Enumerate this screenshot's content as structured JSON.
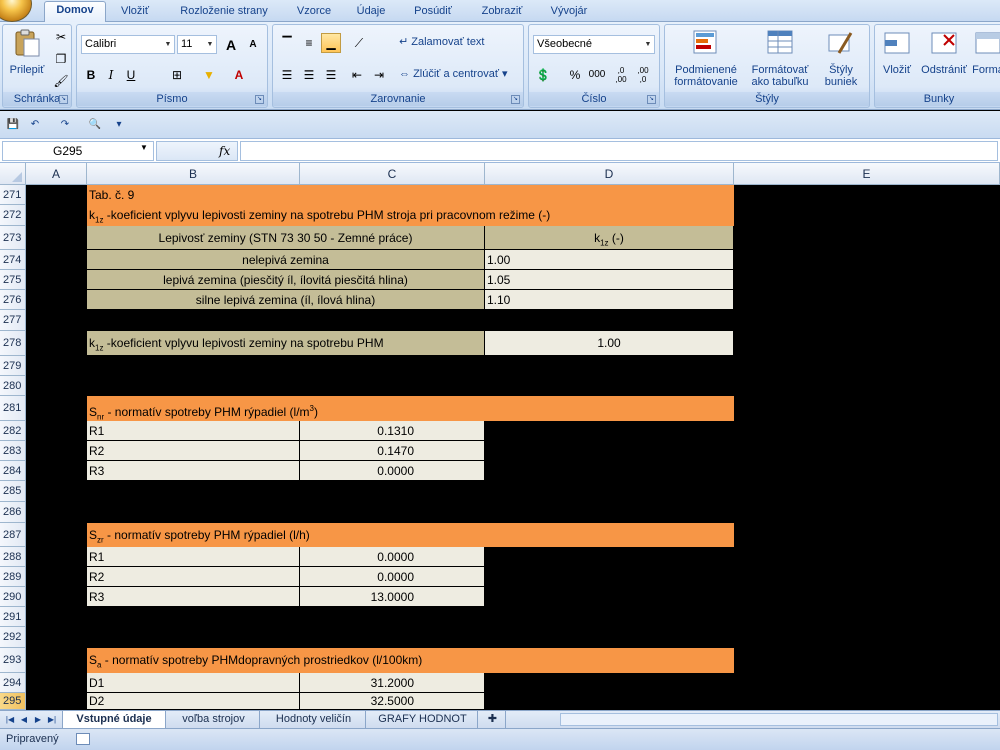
{
  "ribbon": {
    "tabs": [
      "Domov",
      "Vložiť",
      "Rozloženie strany",
      "Vzorce",
      "Údaje",
      "Posúdiť",
      "Zobraziť",
      "Vývojár"
    ],
    "clipboard": {
      "paste_label": "Prilepiť",
      "group_label": "Schránka"
    },
    "font": {
      "name": "Calibri",
      "size": "11",
      "bold": "B",
      "italic": "I",
      "underline": "U",
      "grow": "A",
      "shrink": "A",
      "group_label": "Písmo"
    },
    "alignment": {
      "wrap_label": "Zalamovať text",
      "merge_label": "Zlúčiť a centrovať",
      "group_label": "Zarovnanie"
    },
    "number": {
      "format": "Všeobecné",
      "percent": "%",
      "thousands": "000",
      "inc_dec": ",0 ,00",
      "dec_dec": ",00 ,0",
      "group_label": "Číslo"
    },
    "styles": {
      "cond_format": "Podmienené formátovanie",
      "format_table": "Formátovať ako tabuľku",
      "cell_styles": "Štýly buniek",
      "group_label": "Štýly"
    },
    "cells": {
      "insert": "Vložiť",
      "delete": "Odstrániť",
      "format": "Formá",
      "group_label": "Bunky"
    }
  },
  "formula_bar": {
    "name_box": "G295",
    "fx": "fx",
    "formula": ""
  },
  "columns": [
    "A",
    "B",
    "C",
    "D",
    "E"
  ],
  "rows": {
    "r271": {
      "num": "271",
      "b": "Tab. č. 9"
    },
    "r272": {
      "num": "272",
      "b_sym": "k",
      "b_sub": "1z",
      "b_rest": " -koeficient vplyvu lepivosti zeminy na spotrebu PHM stroja pri pracovnom režime (-)"
    },
    "r273": {
      "num": "273",
      "b": "Lepivosť zeminy (STN 73 30 50 - Zemné práce)",
      "d_sym": "k",
      "d_sub": "1z",
      "d_rest": " (-)"
    },
    "r274": {
      "num": "274",
      "b": "nelepivá zemina",
      "d": "1.00"
    },
    "r275": {
      "num": "275",
      "b": "lepivá zemina (piesčitý íl, ílovitá piesčitá hlina)",
      "d": "1.05"
    },
    "r276": {
      "num": "276",
      "b": "silne lepivá zemina (íl, ílová hlina)",
      "d": "1.10"
    },
    "r277": {
      "num": "277"
    },
    "r278": {
      "num": "278",
      "b_sym": "k",
      "b_sub": "1z",
      "b_rest": " -koeficient vplyvu lepivosti zeminy na spotrebu PHM",
      "d": "1.00"
    },
    "r279": {
      "num": "279"
    },
    "r280": {
      "num": "280"
    },
    "r281": {
      "num": "281",
      "b_sym": "S",
      "b_sub": "nr",
      "b_rest": " - normatív spotreby PHM rýpadiel (l/m",
      "b_sup": "3",
      "b_end": ")"
    },
    "r282": {
      "num": "282",
      "b": "R1",
      "c": "0.1310"
    },
    "r283": {
      "num": "283",
      "b": "R2",
      "c": "0.1470"
    },
    "r284": {
      "num": "284",
      "b": "R3",
      "c": "0.0000"
    },
    "r285": {
      "num": "285"
    },
    "r286": {
      "num": "286"
    },
    "r287": {
      "num": "287",
      "b_sym": "S",
      "b_sub": "zr",
      "b_rest": " - normatív spotreby PHM rýpadiel (l/h)"
    },
    "r288": {
      "num": "288",
      "b": "R1",
      "c": "0.0000"
    },
    "r289": {
      "num": "289",
      "b": "R2",
      "c": "0.0000"
    },
    "r290": {
      "num": "290",
      "b": "R3",
      "c": "13.0000"
    },
    "r291": {
      "num": "291"
    },
    "r292": {
      "num": "292"
    },
    "r293": {
      "num": "293",
      "b_sym": "S",
      "b_sub": "a",
      "b_rest": " - normatív spotreby PHMdopravných prostriedkov (l/100km)"
    },
    "r294": {
      "num": "294",
      "b": "D1",
      "c": "31.2000"
    },
    "r295": {
      "num": "295",
      "b": "D2",
      "c": "32.5000"
    }
  },
  "sheets": [
    "Vstupné údaje",
    "voľba strojov",
    "Hodnoty veličín",
    "GRAFY HODNOT"
  ],
  "status": {
    "text": "Pripravený"
  },
  "colors": {
    "orange": "#f79646",
    "tan": "#c4bd97",
    "cream": "#eeece1",
    "ribbon_text": "#15428b"
  }
}
